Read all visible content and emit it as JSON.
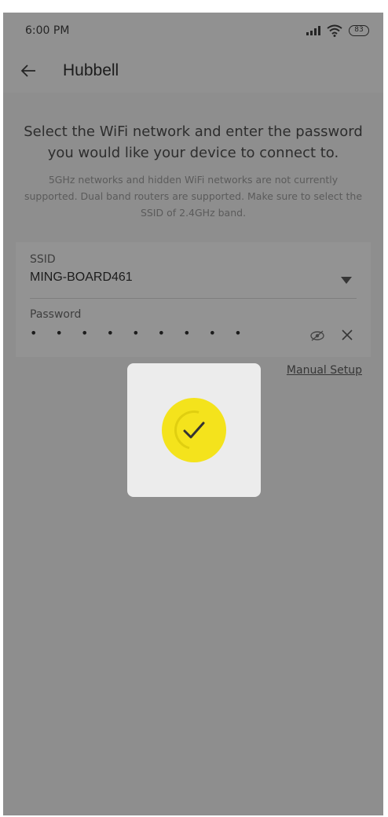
{
  "status_bar": {
    "time": "6:00 PM",
    "battery": "83",
    "icons": [
      "signal-icon",
      "wifi-icon",
      "battery-icon"
    ]
  },
  "app_bar": {
    "back_icon": "arrow-left-icon",
    "title": "Hubbell"
  },
  "intro": {
    "title": "Select the WiFi network and enter the password you would like your device to connect to.",
    "note": "5GHz networks and hidden WiFi networks are not currently supported. Dual band routers are supported. Make sure to select the SSID of 2.4GHz band."
  },
  "form": {
    "ssid": {
      "label": "SSID",
      "value": "MING-BOARD461",
      "icon": "dropdown-arrow-icon"
    },
    "password": {
      "label": "Password",
      "value": "• • • • • • • • •",
      "icons": [
        "eye-icon",
        "clear-icon"
      ]
    }
  },
  "manual_setup": "Manual Setup",
  "loading_dialog": {
    "icon": "checkmark-icon",
    "accent_color": "#f4e31c"
  }
}
